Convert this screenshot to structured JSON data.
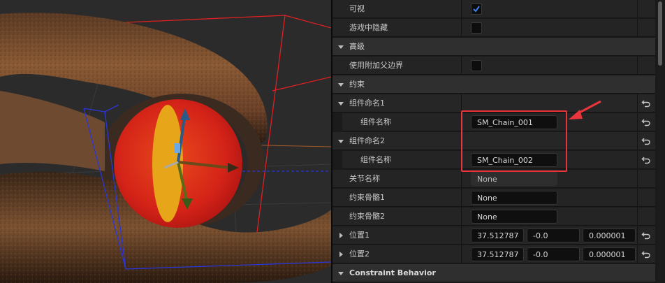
{
  "properties": {
    "visible": {
      "label": "可视",
      "checked": true
    },
    "hidden_in_game": {
      "label": "游戏中隐藏",
      "checked": false
    },
    "advanced": {
      "label": "高级"
    },
    "use_parent_bounds": {
      "label": "使用附加父边界",
      "checked": false
    },
    "constraint": {
      "label": "约束"
    },
    "component_name1": {
      "label": "组件命名1",
      "sub_label": "组件名称",
      "value": "SM_Chain_001"
    },
    "component_name2": {
      "label": "组件命名2",
      "sub_label": "组件名称",
      "value": "SM_Chain_002"
    },
    "joint_name": {
      "label": "关节名称",
      "value": "None"
    },
    "bone1": {
      "label": "约束骨骼1",
      "value": "None"
    },
    "bone2": {
      "label": "约束骨骼2",
      "value": "None"
    },
    "pos1": {
      "label": "位置1",
      "x": "37.512787",
      "y": "-0.0",
      "z": "0.000001"
    },
    "pos2": {
      "label": "位置2",
      "x": "37.512787",
      "y": "-0.0",
      "z": "0.000001"
    },
    "constraint_behavior": {
      "label": "Constraint Behavior"
    }
  },
  "colors": {
    "highlight": "#e8343a",
    "check": "#3b82f6",
    "panel_bg": "#242424",
    "section_bg": "#2f2f2f"
  },
  "icons": {
    "reset": "reset-to-default-icon",
    "check": "checkmark-icon",
    "expand": "triangle-down-icon",
    "collapse": "triangle-right-icon"
  }
}
